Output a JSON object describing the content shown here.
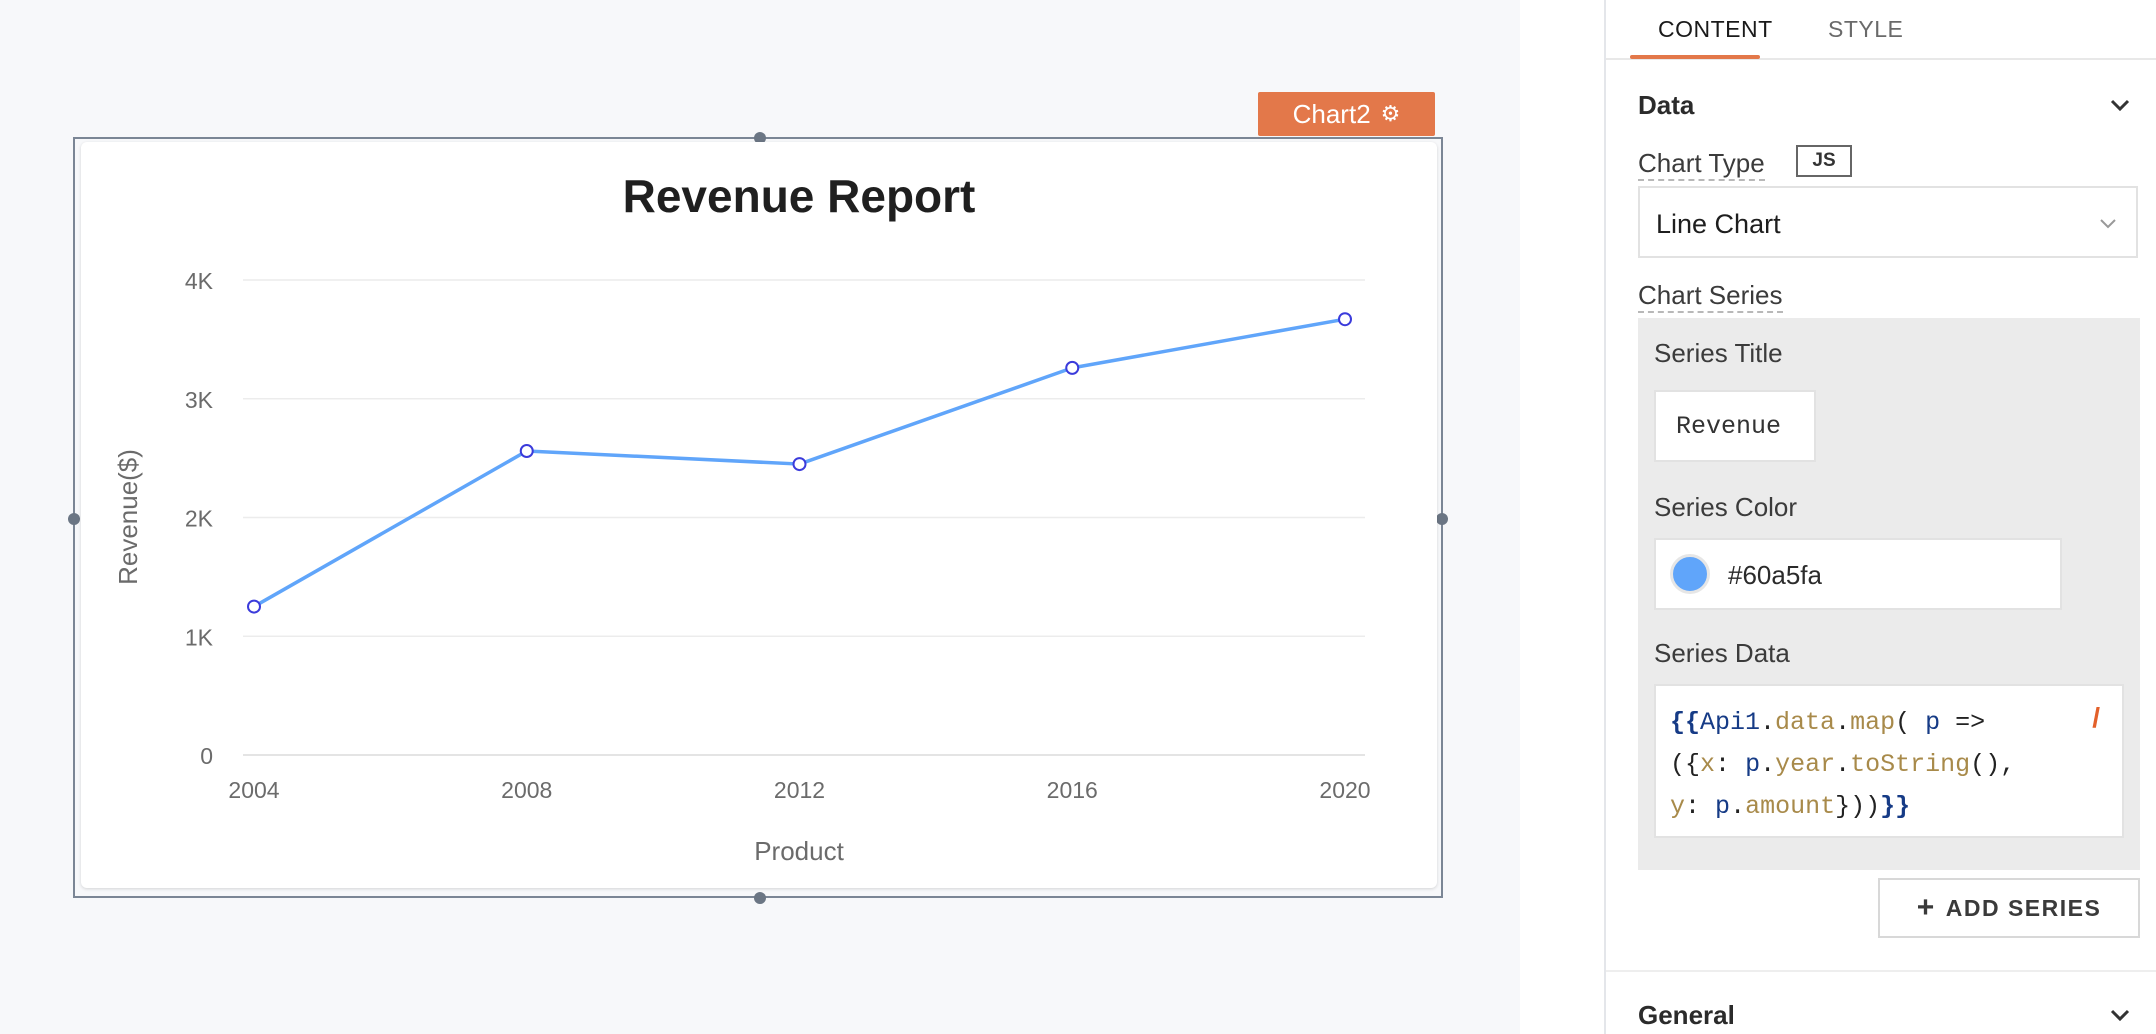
{
  "widget": {
    "name": "Chart2",
    "settings_icon": "gear-icon"
  },
  "chart_data": {
    "type": "line",
    "title": "Revenue Report",
    "xlabel": "Product",
    "ylabel": "Revenue($)",
    "x": [
      "2004",
      "2008",
      "2012",
      "2016",
      "2020"
    ],
    "series": [
      {
        "name": "Revenue",
        "values": [
          1250,
          2560,
          2450,
          3260,
          3670
        ],
        "color": "#60a5fa"
      }
    ],
    "ylim": [
      0,
      4000
    ],
    "yticks": [
      0,
      1000,
      2000,
      3000,
      4000
    ],
    "ytick_labels": [
      "0",
      "1K",
      "2K",
      "3K",
      "4K"
    ],
    "grid": true
  },
  "panel": {
    "tabs": [
      {
        "label": "CONTENT",
        "active": true
      },
      {
        "label": "STYLE",
        "active": false
      }
    ],
    "data_section": {
      "title": "Data",
      "chart_type_label": "Chart Type",
      "js_badge": "JS",
      "chart_type_value": "Line Chart",
      "chart_series_label": "Chart Series",
      "series_title_label": "Series Title",
      "series_title_value": "Revenue",
      "series_color_label": "Series Color",
      "series_color_value": "#60a5fa",
      "series_data_label": "Series Data",
      "series_data_code": "{{Api1.data.map( p => ({x: p.year.toString(), y: p.amount}))}}",
      "add_series_label": "ADD SERIES"
    },
    "general_section": {
      "title": "General"
    }
  }
}
